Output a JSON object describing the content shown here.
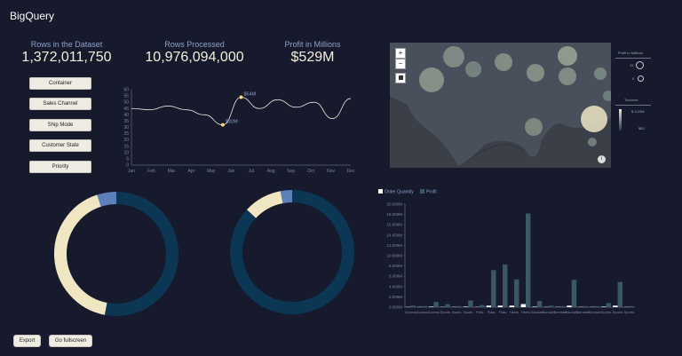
{
  "app": {
    "title": "BigQuery"
  },
  "stats": [
    {
      "label": "Rows in the Dataset",
      "value": "1,372,011,750"
    },
    {
      "label": "Rows Processed",
      "value": "10,976,094,000"
    },
    {
      "label": "Profit in Millions",
      "value": "$529M"
    }
  ],
  "filters": [
    "Container",
    "Sales Channel",
    "Ship Mode",
    "Customer State",
    "Priority"
  ],
  "buttons": {
    "export": "Export",
    "fullscreen": "Go fullscreen"
  },
  "map": {
    "zoom_in": "+",
    "zoom_out": "−",
    "legend_profit_title": "Profit in Millions",
    "legend_profit_items": [
      "15",
      "0"
    ],
    "legend_turnover_title": "Turnover",
    "legend_turnover_items": [
      "$ 3.03M",
      "$82"
    ]
  },
  "line_chart": {
    "type": "line",
    "categories": [
      "Jan",
      "Feb",
      "Mar",
      "Apr",
      "May",
      "Jun",
      "Jul",
      "Aug",
      "Sep",
      "Oct",
      "Nov",
      "Dec"
    ],
    "values": [
      45,
      44,
      47,
      44,
      40,
      32,
      54,
      45,
      52,
      46,
      50,
      37,
      53
    ],
    "yticks": [
      0,
      5,
      10,
      15,
      20,
      25,
      30,
      35,
      40,
      45,
      50,
      55,
      60
    ],
    "ylim": [
      0,
      60
    ],
    "annotations": [
      {
        "label": "$32M",
        "x_index": 5,
        "value": 32
      },
      {
        "label": "$54M",
        "x_index": 6,
        "value": 54
      }
    ]
  },
  "donuts": [
    {
      "segments": [
        {
          "value": 53,
          "color": "#0b3654"
        },
        {
          "value": 42,
          "color": "#f1e6c2"
        },
        {
          "value": 5,
          "color": "#5d7fba"
        }
      ]
    },
    {
      "segments": [
        {
          "value": 87,
          "color": "#0b3654"
        },
        {
          "value": 10,
          "color": "#f1e6c2"
        },
        {
          "value": 3,
          "color": "#5d7fba"
        }
      ]
    }
  ],
  "chart_data": {
    "type": "bar",
    "legend": [
      "Order Quantity",
      "Profit"
    ],
    "yticks": [
      "0.000M",
      "2.000M",
      "4.000M",
      "6.000M",
      "8.000M",
      "10.000M",
      "12.000M",
      "14.000M",
      "16.000M",
      "18.000M",
      "20.000M"
    ],
    "ylim": [
      0,
      20
    ],
    "categories": [
      "Access",
      "Access",
      "Access",
      "Sports",
      "Boots",
      "Boots",
      "Flats",
      "Flats",
      "Flats",
      "Heels",
      "Heels",
      "Sandals",
      "Sandals",
      "Sandals",
      "Sandals",
      "Sandals",
      "Sandals",
      "Sports",
      "Sports",
      "Sports"
    ],
    "series": [
      {
        "name": "Order Quantity",
        "values": [
          0.05,
          0.05,
          0.1,
          0.05,
          0.05,
          0.1,
          0.05,
          0.3,
          0.3,
          0.3,
          0.6,
          0.1,
          0.05,
          0.05,
          0.3,
          0.05,
          0.05,
          0.1,
          0.3,
          0.05
        ]
      },
      {
        "name": "Profit",
        "values": [
          0.3,
          0.2,
          1.0,
          0.6,
          0.2,
          1.3,
          0.4,
          7.2,
          8.3,
          5.4,
          18.2,
          1.2,
          0.3,
          0.2,
          5.3,
          0.2,
          0.2,
          0.8,
          4.9,
          0.2
        ]
      }
    ],
    "colors": {
      "Order Quantity": "#ffffff",
      "Profit": "#3b5866"
    }
  }
}
